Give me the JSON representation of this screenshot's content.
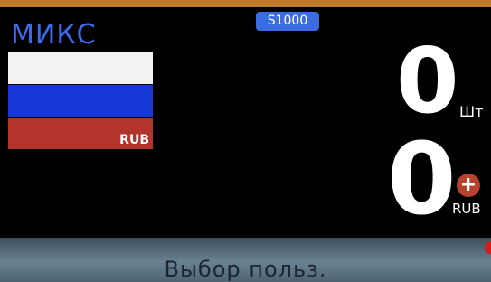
{
  "header": {
    "mode": "МИКС",
    "model_badge": "S1000"
  },
  "currency_panel": {
    "flag_icon": "russia-flag-icon",
    "code": "RUB"
  },
  "counter": {
    "pieces_value": "0",
    "pieces_unit": "Шт",
    "amount_value": "0",
    "amount_icon": "plus-icon",
    "amount_currency": "RUB"
  },
  "status_bar": {
    "text": "Выбор польз."
  },
  "colors": {
    "mode_blue": "#3b6cf0",
    "badge_blue": "#3b6ce0",
    "flag_white": "#f3f3f3",
    "flag_blue": "#1737d6",
    "flag_red": "#b3332d",
    "plus_icon_red": "#b5432d",
    "status_bar": "#6a8292"
  }
}
